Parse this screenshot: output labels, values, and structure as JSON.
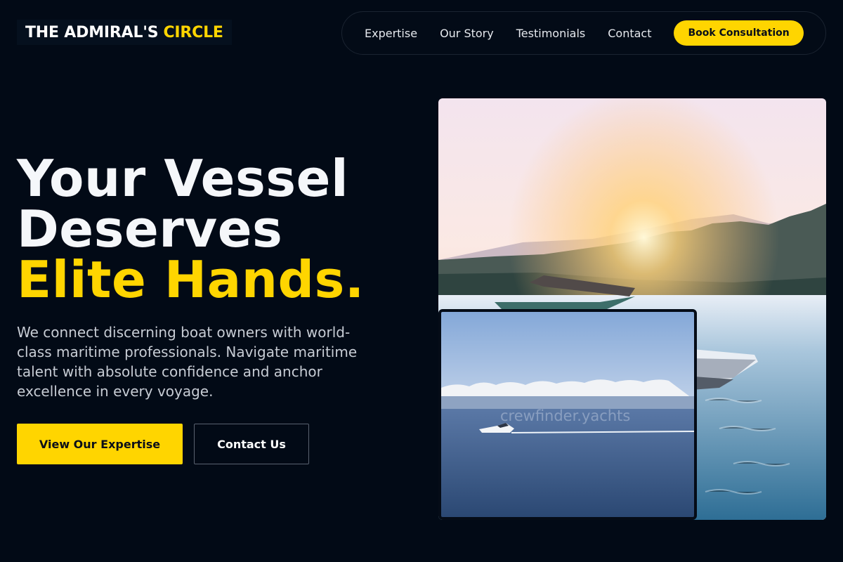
{
  "brand": {
    "name_main": "THE ADMIRAL'S",
    "name_accent": "CIRCLE"
  },
  "nav": {
    "items": [
      "Expertise",
      "Our Story",
      "Testimonials",
      "Contact"
    ],
    "cta_label": "Book Consultation"
  },
  "hero": {
    "headline_line1": "Your Vessel",
    "headline_line2": "Deserves",
    "headline_line3": "Elite Hands.",
    "lead": "We connect discerning boat owners with world-class maritime professionals. Navigate maritime talent with absolute confidence and anchor excellence in every voyage.",
    "primary_button": "View Our Expertise",
    "secondary_button": "Contact Us"
  },
  "images": {
    "inset_watermark": "crewfinder.yachts"
  },
  "colors": {
    "background": "#020a16",
    "accent": "#ffd500",
    "text": "#f5f7fa",
    "muted_text": "#c7ccd4"
  }
}
